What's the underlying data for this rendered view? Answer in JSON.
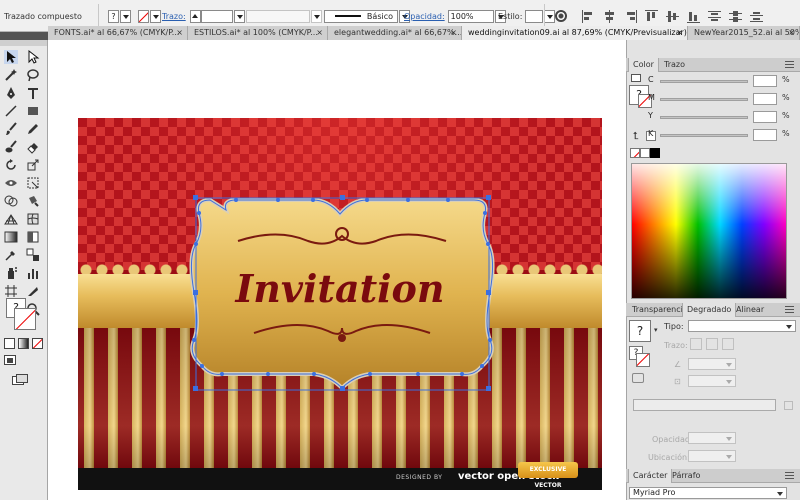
{
  "control_bar": {
    "object_type": "Trazado compuesto",
    "fill_indicator": "?",
    "stroke_label": "Trazo:",
    "stroke_style": "Básico",
    "opacity_label": "Opacidad:",
    "opacity_value": "100%",
    "style_label": "Estilo:"
  },
  "tabs": [
    {
      "label": "FONTS.ai* al 66,67% (CMYK/P...",
      "close": "×"
    },
    {
      "label": "ESTILOS.ai* al 100% (CMYK/P...",
      "close": "×"
    },
    {
      "label": "elegantwedding.ai* al 66,67%...",
      "close": "×"
    },
    {
      "label": "weddinginvitation09.ai al 87,69% (CMYK/Previsualizar)",
      "close": "×"
    },
    {
      "label": "NewYear2015_52.ai al 50% (C...",
      "close": "×"
    }
  ],
  "artboard": {
    "title_text": "Invitation",
    "footer_text": "DESIGNED BY",
    "footer_brand": "vector open stock",
    "ribbon_text": "EXCLUSIVE VECTOR"
  },
  "color_panel": {
    "tabs": [
      "Color",
      "Trazo"
    ],
    "fill_question": "?",
    "rows": [
      {
        "letter": "C",
        "unit": "%"
      },
      {
        "letter": "M",
        "unit": "%"
      },
      {
        "letter": "Y",
        "unit": "%"
      },
      {
        "letter": "K",
        "unit": "%"
      }
    ]
  },
  "gradient_panel": {
    "tabs": [
      "Transparencia",
      "Degradado",
      "Alinear"
    ],
    "fill_question": "?",
    "stroke_question": "?",
    "type_label": "Tipo:",
    "stroke_label": "Trazo:",
    "opacity_label": "Opacidad:",
    "location_label": "Ubicación:"
  },
  "character_panel": {
    "tabs": [
      "Carácter",
      "Párrafo"
    ],
    "font_name": "Myriad Pro"
  },
  "colors": {
    "accent_blue": "#2a5fb0",
    "selection_blue": "#3b6fe0"
  }
}
